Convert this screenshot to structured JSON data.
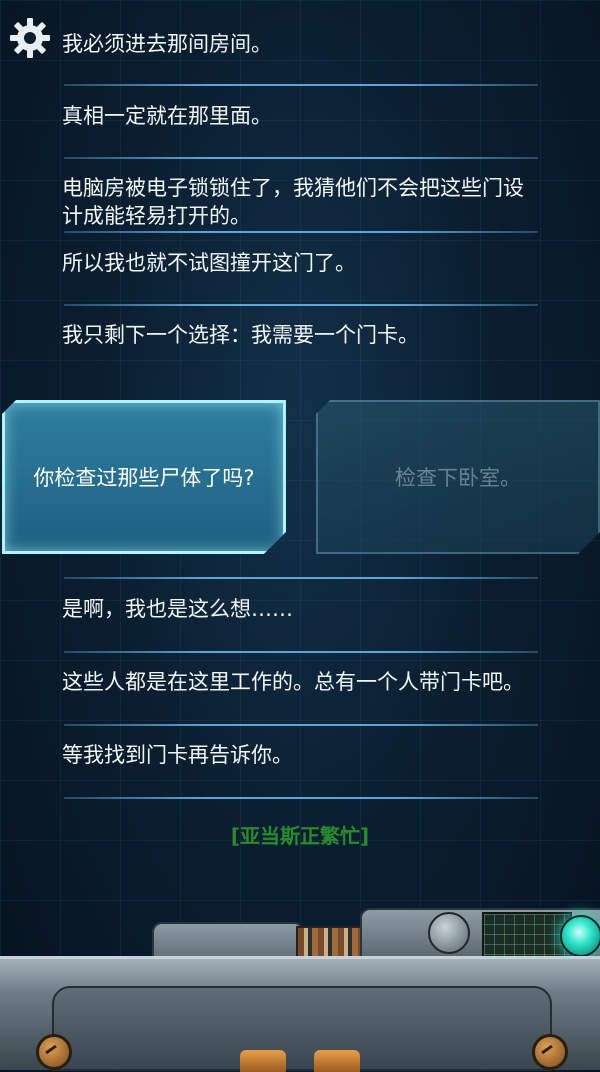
{
  "settings": {
    "icon": "gear-icon"
  },
  "messages": [
    "我必须进去那间房间。",
    "真相一定就在那里面。",
    "电脑房被电子锁锁住了，我猜他们不会把这些门设计成能轻易打开的。",
    "所以我也就不试图撞开这门了。",
    "我只剩下一个选择：我需要一个门卡。"
  ],
  "choices": {
    "left": "你检查过那些尸体了吗?",
    "right": "检查下卧室。"
  },
  "replies": [
    "是啊，我也是这么想……",
    "这些人都是在这里工作的。总有一个人带门卡吧。",
    "等我找到门卡再告诉你。"
  ],
  "status": "[亚当斯正繁忙]",
  "colors": {
    "accent": "#5aa6e0",
    "choice_active": "#2f7fa0",
    "choice_border": "#aef4ff",
    "status": "#2a8a2c",
    "led": "#2be3c9"
  }
}
